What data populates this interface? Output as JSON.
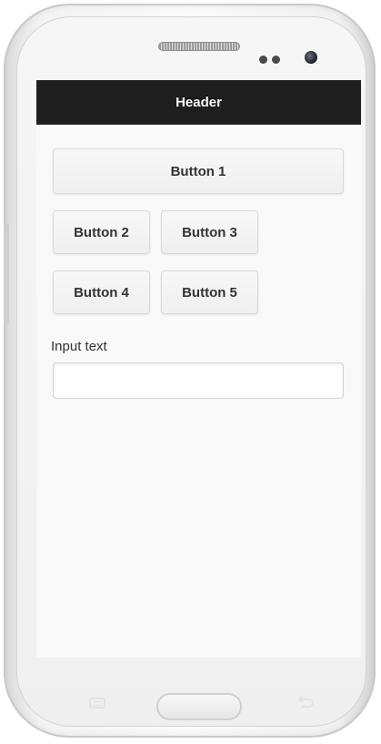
{
  "device": {
    "buttons": {
      "menu_icon": "menu-icon",
      "home_icon": "home-button",
      "back_icon": "back-arrow-icon"
    }
  },
  "app": {
    "header": {
      "title": "Header"
    },
    "buttons": [
      {
        "label": "Button 1"
      },
      {
        "label": "Button 2"
      },
      {
        "label": "Button 3"
      },
      {
        "label": "Button 4"
      },
      {
        "label": "Button 5"
      }
    ],
    "input": {
      "label": "Input text",
      "value": "",
      "placeholder": ""
    }
  },
  "colors": {
    "header_bg": "#1e1e1e",
    "header_text": "#ffffff",
    "screen_bg": "#f9f9f9",
    "button_bg": "#f3f3f3",
    "button_text": "#333333"
  }
}
